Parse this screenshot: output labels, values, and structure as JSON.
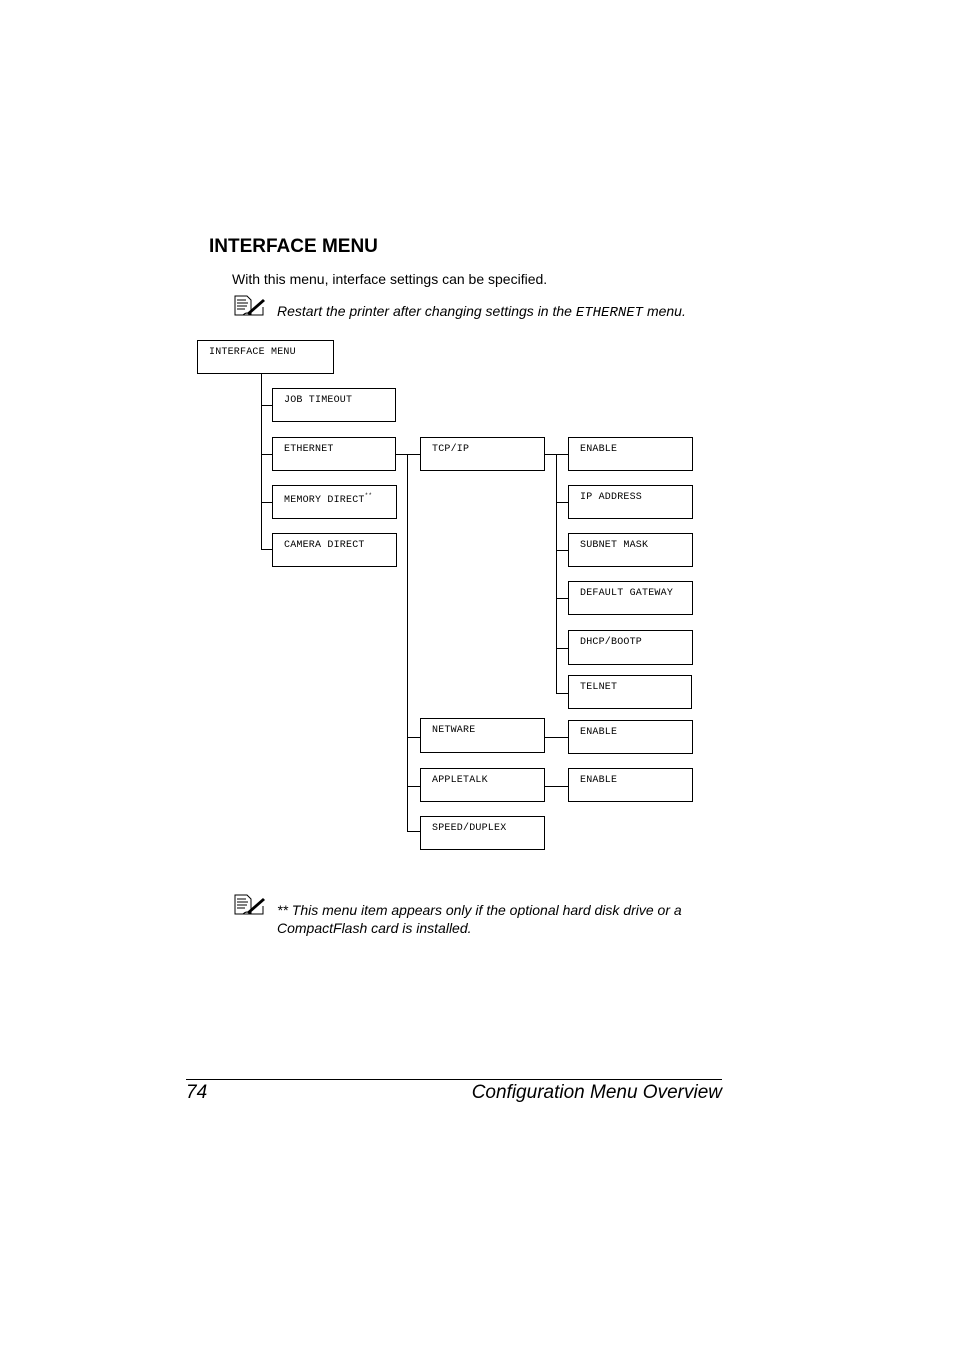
{
  "section": {
    "heading": "INTERFACE MENU",
    "intro": "With this menu, interface settings can be specified."
  },
  "notes": [
    {
      "icon": "note-pencil-icon",
      "text_before": "Restart the printer after changing settings in the ",
      "code": "ETHERNET",
      "text_after": " menu."
    },
    {
      "icon": "note-pencil-icon",
      "line1": "** This menu item appears only if the optional hard disk drive or a",
      "line2": "CompactFlash card is installed."
    }
  ],
  "diagram": {
    "root": "INTERFACE MENU",
    "level1": [
      "JOB TIMEOUT",
      "ETHERNET",
      "MEMORY DIRECT",
      "CAMERA DIRECT"
    ],
    "memory_direct_mark": "**",
    "ethernet_children": [
      "TCP/IP",
      "NETWARE",
      "APPLETALK",
      "SPEED/DUPLEX"
    ],
    "tcpip_children": [
      "ENABLE",
      "IP ADDRESS",
      "SUBNET MASK",
      "DEFAULT GATEWAY",
      "DHCP/BOOTP",
      "TELNET"
    ],
    "netware_children": [
      "ENABLE"
    ],
    "appletalk_children": [
      "ENABLE"
    ]
  },
  "footer": {
    "page_number": "74",
    "title": "Configuration Menu Overview"
  }
}
